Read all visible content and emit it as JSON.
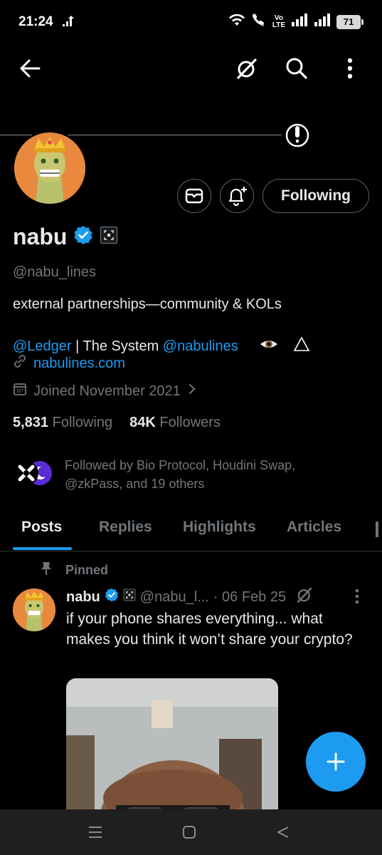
{
  "status_bar": {
    "time": "21:24",
    "volte_top": "Vo",
    "volte_bottom": "LTE",
    "battery": "71"
  },
  "top_nav": {
    "back_icon": "arrow-left-icon",
    "grok_icon": "grok-icon",
    "search_icon": "search-icon",
    "more_icon": "more-vertical-icon"
  },
  "profile": {
    "display_name": "nabu",
    "handle": "@nabu_lines",
    "verified": true,
    "following_button": "Following",
    "bio_line1": "external partnerships—community & KOLs",
    "bio_mention1": "@Ledger",
    "bio_middle": " | The System ",
    "bio_mention2": "@nabulines",
    "website": "nabulines.com",
    "joined": "Joined November 2021",
    "following_count": "5,831",
    "following_label": "Following",
    "followers_count": "84K",
    "followers_label": "Followers",
    "followed_by": "Followed by Bio Protocol, Houdini Swap, @zkPass, and 19 others"
  },
  "tabs": [
    {
      "label": "Posts",
      "active": true
    },
    {
      "label": "Replies",
      "active": false
    },
    {
      "label": "Highlights",
      "active": false
    },
    {
      "label": "Articles",
      "active": false
    }
  ],
  "pinned_post": {
    "pinned_label": "Pinned",
    "author": "nabu",
    "handle": "@nabu_l...",
    "date": "· 06 Feb 25",
    "text": "if your phone shares everything... what makes you think it won’t share your crypto?"
  },
  "colors": {
    "background": "#000000",
    "accent": "#1d9bf0",
    "secondary_text": "#71767b",
    "primary_text": "#e7e9ea"
  }
}
